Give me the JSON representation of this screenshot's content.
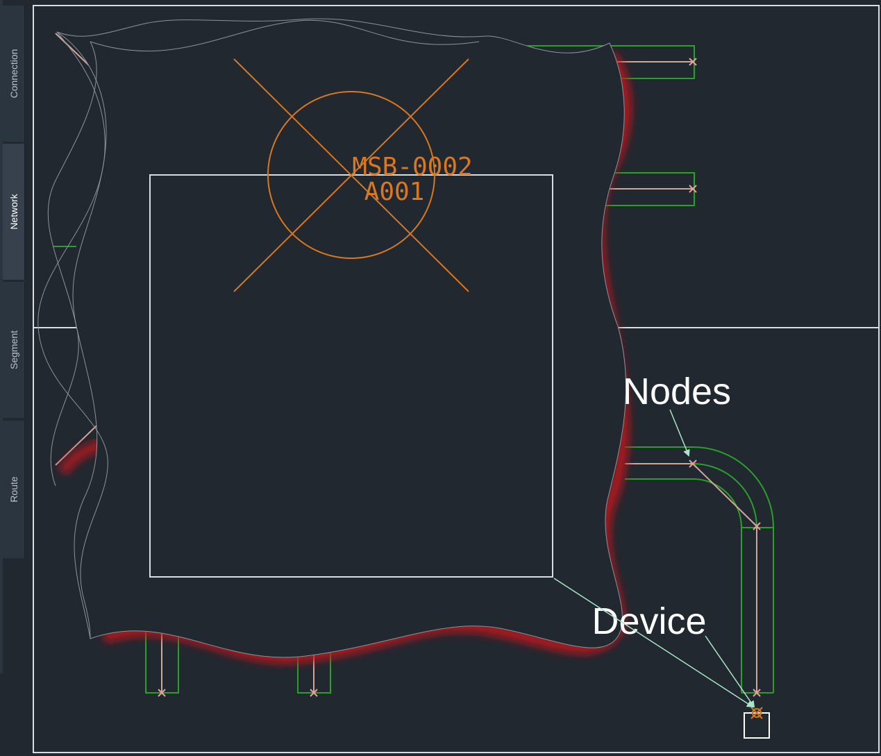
{
  "palette_tabs": [
    {
      "label": "Connection",
      "active": false
    },
    {
      "label": "Network",
      "active": true
    },
    {
      "label": "Segment",
      "active": false
    },
    {
      "label": "Route",
      "active": false
    }
  ],
  "drawing": {
    "device_tag_line1": "MSB-0002",
    "device_tag_line2": "A001",
    "callout_nodes": "Nodes",
    "callout_device": "Device"
  },
  "colors": {
    "background": "#212830",
    "border": "#d9dde2",
    "raceway": "#2aa02a",
    "route_line": "#d4a59a",
    "device_symbol": "#d9781f",
    "callout_leader": "#a7e6c8",
    "wave_shadow": "#c0161c",
    "node_marker": "#e8a0a0"
  }
}
